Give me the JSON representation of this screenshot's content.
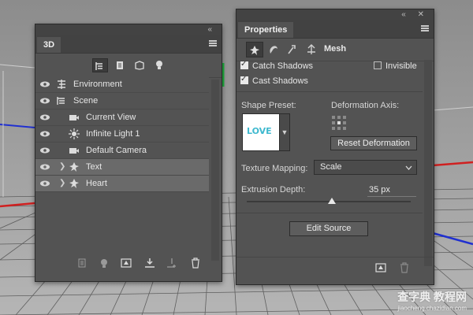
{
  "panel_3d": {
    "tab": "3D",
    "layers": [
      {
        "label": "Environment",
        "icon": "environment-icon",
        "selected": false
      },
      {
        "label": "Scene",
        "icon": "scene-icon",
        "selected": false
      },
      {
        "label": "Current View",
        "icon": "camera-icon",
        "selected": false
      },
      {
        "label": "Infinite Light 1",
        "icon": "light-icon",
        "selected": false
      },
      {
        "label": "Default Camera",
        "icon": "camera-icon",
        "selected": false
      },
      {
        "label": "Text",
        "icon": "mesh-icon",
        "selected": true
      },
      {
        "label": "Heart",
        "icon": "mesh-icon",
        "selected": true
      }
    ]
  },
  "properties": {
    "tab": "Properties",
    "section": "Mesh",
    "catch_shadows": {
      "label": "Catch Shadows",
      "checked": true
    },
    "invisible": {
      "label": "Invisible",
      "checked": false
    },
    "cast_shadows": {
      "label": "Cast Shadows",
      "checked": true
    },
    "shape_preset_label": "Shape Preset:",
    "shape_preset_thumb": "LOVE",
    "deformation_axis_label": "Deformation Axis:",
    "reset_deformation": "Reset Deformation",
    "texture_mapping_label": "Texture Mapping:",
    "texture_mapping_value": "Scale",
    "extrusion_depth_label": "Extrusion Depth:",
    "extrusion_depth_value": "35 px",
    "extrusion_depth_slider_fraction": 0.52,
    "edit_source": "Edit Source"
  },
  "watermark": {
    "line1": "查字典 教程网",
    "line2": "jiaocheng.chazidian.com"
  },
  "colors": {
    "panel": "#535353",
    "accent_cyan": "#3fb9cf"
  }
}
